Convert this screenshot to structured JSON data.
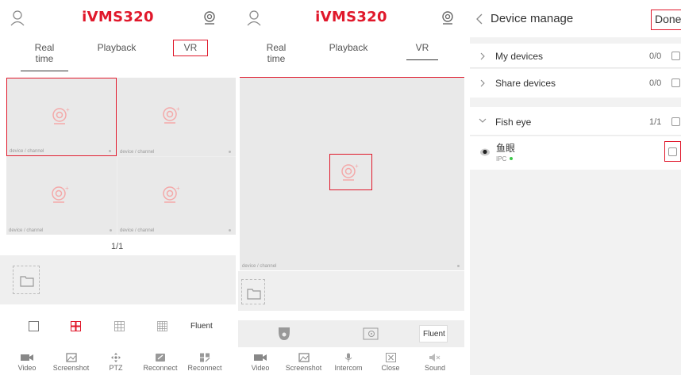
{
  "app_title": "iVMS320",
  "tabs": [
    "Real time",
    "Playback",
    "VR"
  ],
  "cell_label": "device / channel",
  "page_indicator": "1/1",
  "fluent_label": "Fluent",
  "toolbar1": [
    "Video",
    "Screenshot",
    "PTZ",
    "Reconnect",
    "Reconnect"
  ],
  "toolbar2": [
    "Video",
    "Screenshot",
    "Intercom",
    "Close",
    "Sound"
  ],
  "device_manage": {
    "title": "Device manage",
    "done_label": "Done",
    "groups": [
      {
        "label": "My devices",
        "count": "0/0"
      },
      {
        "label": "Share devices",
        "count": "0/0"
      },
      {
        "label": "Fish eye",
        "count": "1/1"
      }
    ],
    "device": {
      "name": "鱼眼",
      "type": "IPC"
    }
  },
  "colors": {
    "accent": "#e0182b",
    "online": "#3ec84b"
  }
}
